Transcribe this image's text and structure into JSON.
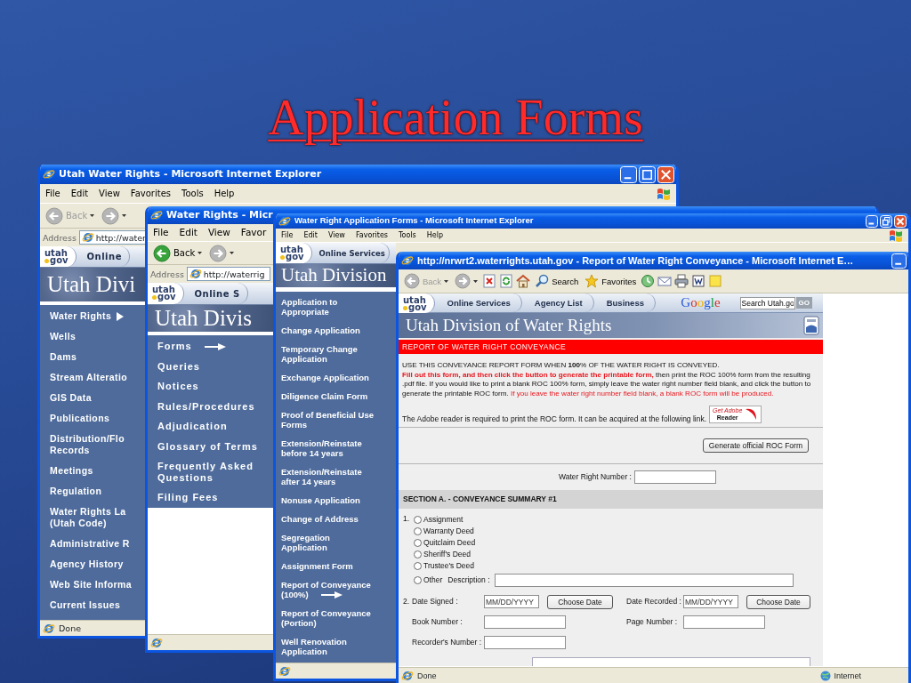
{
  "slide": {
    "title": "Application Forms"
  },
  "windows": [
    {
      "title": "Utah Water Rights - Microsoft Internet Explorer",
      "maximized": false,
      "menu": [
        "File",
        "Edit",
        "View",
        "Favorites",
        "Tools",
        "Help"
      ],
      "flag": true,
      "toolbar": [
        {
          "kind": "back",
          "label": "Back",
          "disabled": true
        },
        {
          "kind": "forward",
          "disabled": true
        }
      ],
      "address": {
        "label": "Address",
        "url": "http://water"
      },
      "site": {
        "logo": [
          "utah",
          "gov"
        ],
        "tabs": [
          "Online"
        ],
        "banner": "Utah Divi",
        "nav": [
          {
            "lines": [
              "Water Rights"
            ],
            "marked": true
          },
          {
            "lines": [
              "Wells"
            ],
            "marked": false
          },
          {
            "lines": [
              "Dams"
            ],
            "marked": false
          },
          {
            "lines": [
              "Stream Alteratio"
            ],
            "marked": false
          },
          {
            "lines": [
              "GIS Data"
            ],
            "marked": false
          },
          {
            "lines": [
              "Publications"
            ],
            "marked": false
          },
          {
            "lines": [
              "Distribution/Flo",
              "Records"
            ],
            "marked": false
          },
          {
            "lines": [
              "Meetings"
            ],
            "marked": false
          },
          {
            "lines": [
              "Regulation"
            ],
            "marked": false
          },
          {
            "lines": [
              "Water Rights La",
              "(Utah Code)"
            ],
            "marked": false
          },
          {
            "lines": [
              "Administrative R"
            ],
            "marked": false
          },
          {
            "lines": [
              "Agency History"
            ],
            "marked": false
          },
          {
            "lines": [
              "Web Site Informa"
            ],
            "marked": false
          },
          {
            "lines": [
              "Current Issues"
            ],
            "marked": false
          }
        ]
      },
      "status_text": "Done"
    },
    {
      "title": "Water Rights - Micr",
      "menu": [
        "File",
        "Edit",
        "View",
        "Favor"
      ],
      "toolbar": [
        {
          "kind": "back",
          "label": "Back",
          "disabled": false
        },
        {
          "kind": "forward",
          "disabled": true
        }
      ],
      "address": {
        "label": "Address",
        "url": "http://waterrig"
      },
      "site": {
        "logo": [
          "utah",
          "gov"
        ],
        "tabs": [
          "Online S"
        ],
        "banner": "Utah Divis",
        "nav": [
          {
            "lines": [
              "Forms"
            ],
            "marked": true
          },
          {
            "lines": [
              "Queries"
            ],
            "marked": false
          },
          {
            "lines": [
              "Notices"
            ],
            "marked": false
          },
          {
            "lines": [
              "Rules/Procedures"
            ],
            "marked": false
          },
          {
            "lines": [
              "Adjudication"
            ],
            "marked": false
          },
          {
            "lines": [
              "Glossary of Terms"
            ],
            "marked": false
          },
          {
            "lines": [
              "Frequently Asked",
              "Questions"
            ],
            "marked": false
          },
          {
            "lines": [
              "Filing Fees"
            ],
            "marked": false
          }
        ]
      }
    },
    {
      "title": "Water Right Application Forms - Microsoft Internet Explorer",
      "maximized": true,
      "menu": [
        "File",
        "Edit",
        "View",
        "Favorites",
        "Tools",
        "Help"
      ],
      "flag": true,
      "site": {
        "logo": [
          "utah",
          "gov"
        ],
        "tabs": [
          "Online Services"
        ],
        "banner": "Utah Division",
        "nav": [
          {
            "lines": [
              "Application to",
              "Appropriate"
            ],
            "marked": false
          },
          {
            "lines": [
              "Change Application"
            ],
            "marked": false
          },
          {
            "lines": [
              "Temporary Change",
              "Application"
            ],
            "marked": false
          },
          {
            "lines": [
              "Exchange Application"
            ],
            "marked": false
          },
          {
            "lines": [
              "Diligence Claim Form"
            ],
            "marked": false
          },
          {
            "lines": [
              "Proof of Beneficial Use",
              "Forms"
            ],
            "marked": false
          },
          {
            "lines": [
              "Extension/Reinstate",
              "before 14 years"
            ],
            "marked": false
          },
          {
            "lines": [
              "Extension/Reinstate",
              "after 14 years"
            ],
            "marked": false
          },
          {
            "lines": [
              "Nonuse Application"
            ],
            "marked": false
          },
          {
            "lines": [
              "Change of Address"
            ],
            "marked": false
          },
          {
            "lines": [
              "Segregation",
              "Application"
            ],
            "marked": false
          },
          {
            "lines": [
              "Assignment Form"
            ],
            "marked": false
          },
          {
            "lines": [
              "Report of Conveyance",
              "(100%)"
            ],
            "marked": true
          },
          {
            "lines": [
              "Report of Conveyance",
              "(Portion)"
            ],
            "marked": false
          },
          {
            "lines": [
              "Well Renovation",
              "Application"
            ],
            "marked": false
          }
        ]
      }
    }
  ],
  "report_window": {
    "title": "http://nrwrt2.waterrights.utah.gov - Report of Water Right Conveyance - Microsoft Internet E…",
    "toolbar": [
      {
        "kind": "back",
        "label": "Back",
        "disabled": true
      },
      {
        "kind": "forward",
        "disabled": true
      },
      {
        "kind": "stop"
      },
      {
        "kind": "refresh"
      },
      {
        "kind": "home"
      },
      {
        "kind": "search",
        "label": "Search"
      },
      {
        "kind": "favorites",
        "label": "Favorites"
      },
      {
        "kind": "history"
      },
      {
        "kind": "mail"
      },
      {
        "kind": "print"
      },
      {
        "kind": "edit"
      },
      {
        "kind": "note"
      }
    ],
    "site": {
      "logo": [
        "utah",
        "gov"
      ],
      "tabs": [
        "Online Services",
        "Agency List",
        "Business"
      ],
      "search_logo": "Google",
      "search": {
        "value": "Search Utah.go",
        "button": "GO"
      },
      "banner": "Utah Division of Water Rights"
    },
    "page_header": "REPORT OF WATER RIGHT CONVEYANCE",
    "notice": "USE THIS CONVEYANCE REPORT FORM WHEN **100**% OF THE WATER RIGHT IS CONVEYED.",
    "instructions": [
      {
        "kind": "alert",
        "text": "**Fill out this form, and then click the button to generate the printable form,**"
      },
      {
        "kind": "plain",
        "text": "then print the ROC 100% form from the resulting .pdf file. If you would like to print a blank ROC 100% form, simply leave the water right number field blank, and click the button to generate the printable ROC form."
      },
      {
        "kind": "alert",
        "text": "If you leave the water right number field blank, a blank ROC form will be produced."
      }
    ],
    "adobe": {
      "text": "The Adobe reader is required to print the ROC form. It can be acquired at the following link.",
      "badge": [
        "Get Adobe",
        "Reader"
      ]
    },
    "generate_button": "Generate official ROC Form",
    "water_right_number": {
      "label": "Water Right Number :"
    },
    "section": "SECTION A. - CONVEYANCE SUMMARY #1",
    "form": {
      "conveyance_type": {
        "number": "1.",
        "options": [
          {
            "label": "Assignment",
            "selected": false
          },
          {
            "label": "Warranty Deed",
            "selected": false
          },
          {
            "label": "Quitclaim Deed",
            "selected": false
          },
          {
            "label": "Sheriff's Deed",
            "selected": false
          },
          {
            "label": "Trustee's Deed",
            "selected": false
          },
          {
            "label": "Other",
            "selected": false
          }
        ],
        "description": {
          "label": "Description :"
        }
      },
      "dates": {
        "number": "2.",
        "signed": {
          "label": "Date Signed :",
          "value": "MM/DD/YYYY",
          "button": "Choose Date"
        },
        "recorded": {
          "label": "Date Recorded :",
          "value": "MM/DD/YYYY",
          "button": "Choose Date"
        }
      },
      "book_number": {
        "label": "Book Number :"
      },
      "page_number": {
        "label": "Page Number :"
      },
      "recorders_number": {
        "label": "Recorder's Number :"
      },
      "partial_field": {
        "kind": "textarea"
      }
    },
    "status_text": "Done",
    "zone": "Internet"
  }
}
